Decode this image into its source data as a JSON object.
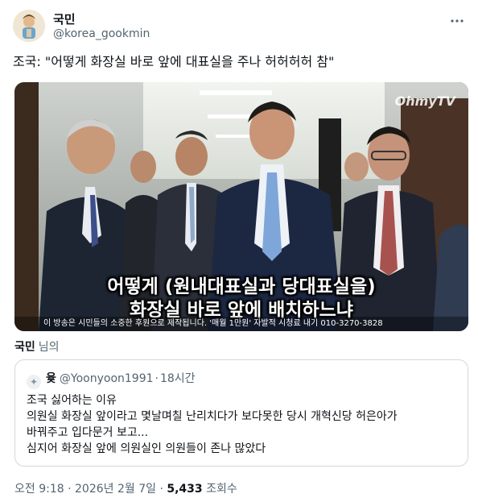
{
  "author": {
    "name": "국민",
    "handle": "@korea_gookmin"
  },
  "tweet": {
    "text": "조국: \"어떻게 화장실 바로 앞에 대표실을 주나 허허허허 참\""
  },
  "media": {
    "watermark": "OhmyTV",
    "subtitle_line1": "어떻게 (원내대표실과 당대표실을)",
    "subtitle_line2": "화장실 바로 앞에 배치하느냐",
    "ticker": "이 방송은 시민들의 소중한 후원으로 제작됩니다. '매월 1만원' 자발적 시청료 내기 010-3270-3828"
  },
  "tagged": {
    "name": "국민",
    "suffix": "님의"
  },
  "quote": {
    "name": "윷",
    "handle": "@Yoonyoon1991",
    "dot": "·",
    "time": "18시간",
    "lines": [
      "조국 싫어하는 이유",
      "의원실 화장실 앞이라고 몇날며칠 난리치다가 보다못한 당시 개혁신당 허은아가",
      "바꿔주고 입다문거 보고...",
      "심지어 화장실 앞에 의원실인 의원들이 존나 많았다"
    ]
  },
  "meta": {
    "time": "오전 9:18",
    "sep1": "·",
    "date": "2026년 2월 7일",
    "sep2": "·",
    "views": "5,433",
    "views_label": "조회수"
  },
  "icons": {
    "more": "more-horizontal-icon",
    "quote_avatar": "sparkle-avatar-icon"
  }
}
